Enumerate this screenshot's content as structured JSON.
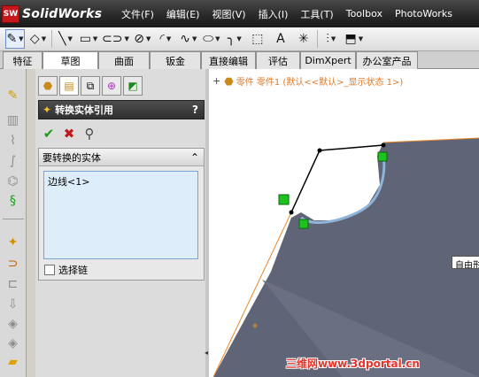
{
  "app": {
    "logo_mark": "SW",
    "name": "SolidWorks"
  },
  "menu": [
    "文件(F)",
    "编辑(E)",
    "视图(V)",
    "插入(I)",
    "工具(T)",
    "Toolbox",
    "PhotoWorks"
  ],
  "toolbar_icons": [
    "sketch-icon",
    "smart-dimension-icon",
    "line-icon",
    "rectangle-icon",
    "slot-icon",
    "circle-icon",
    "arc-icon",
    "spline-icon",
    "ellipse-icon",
    "fillet-icon",
    "construction-geometry-icon",
    "text-icon",
    "point-icon",
    "mirror-icon",
    "display-style-icon"
  ],
  "tabs": [
    {
      "label": "特征",
      "active": false
    },
    {
      "label": "草图",
      "active": true
    },
    {
      "label": "曲面",
      "active": false
    },
    {
      "label": "钣金",
      "active": false
    },
    {
      "label": "直接编辑",
      "active": false
    },
    {
      "label": "评估",
      "active": false
    },
    {
      "label": "DimXpert",
      "active": false
    },
    {
      "label": "办公室产品",
      "active": false
    }
  ],
  "property_manager": {
    "title": "转换实体引用",
    "help": "?",
    "tab_icons": [
      "feature-manager-icon",
      "property-manager-icon",
      "configuration-manager-icon",
      "dimxpert-manager-icon",
      "display-manager-icon"
    ],
    "group": {
      "title": "要转换的实体",
      "collapse": "⌃",
      "items": [
        "边线<1>"
      ],
      "select_chain_label": "选择链"
    }
  },
  "feature_tree": {
    "expand": "+",
    "text": "零件  零件1  (默认<<默认>_显示状态 1>)"
  },
  "tooltip": "自由形",
  "watermark": "三维网www.3dportal.cn",
  "colors": {
    "accent": "#2f66b8",
    "face": "#5f6476",
    "edge": "#e8872c",
    "endpoint": "#1ec21e",
    "highlight": "#8fb4d9"
  }
}
